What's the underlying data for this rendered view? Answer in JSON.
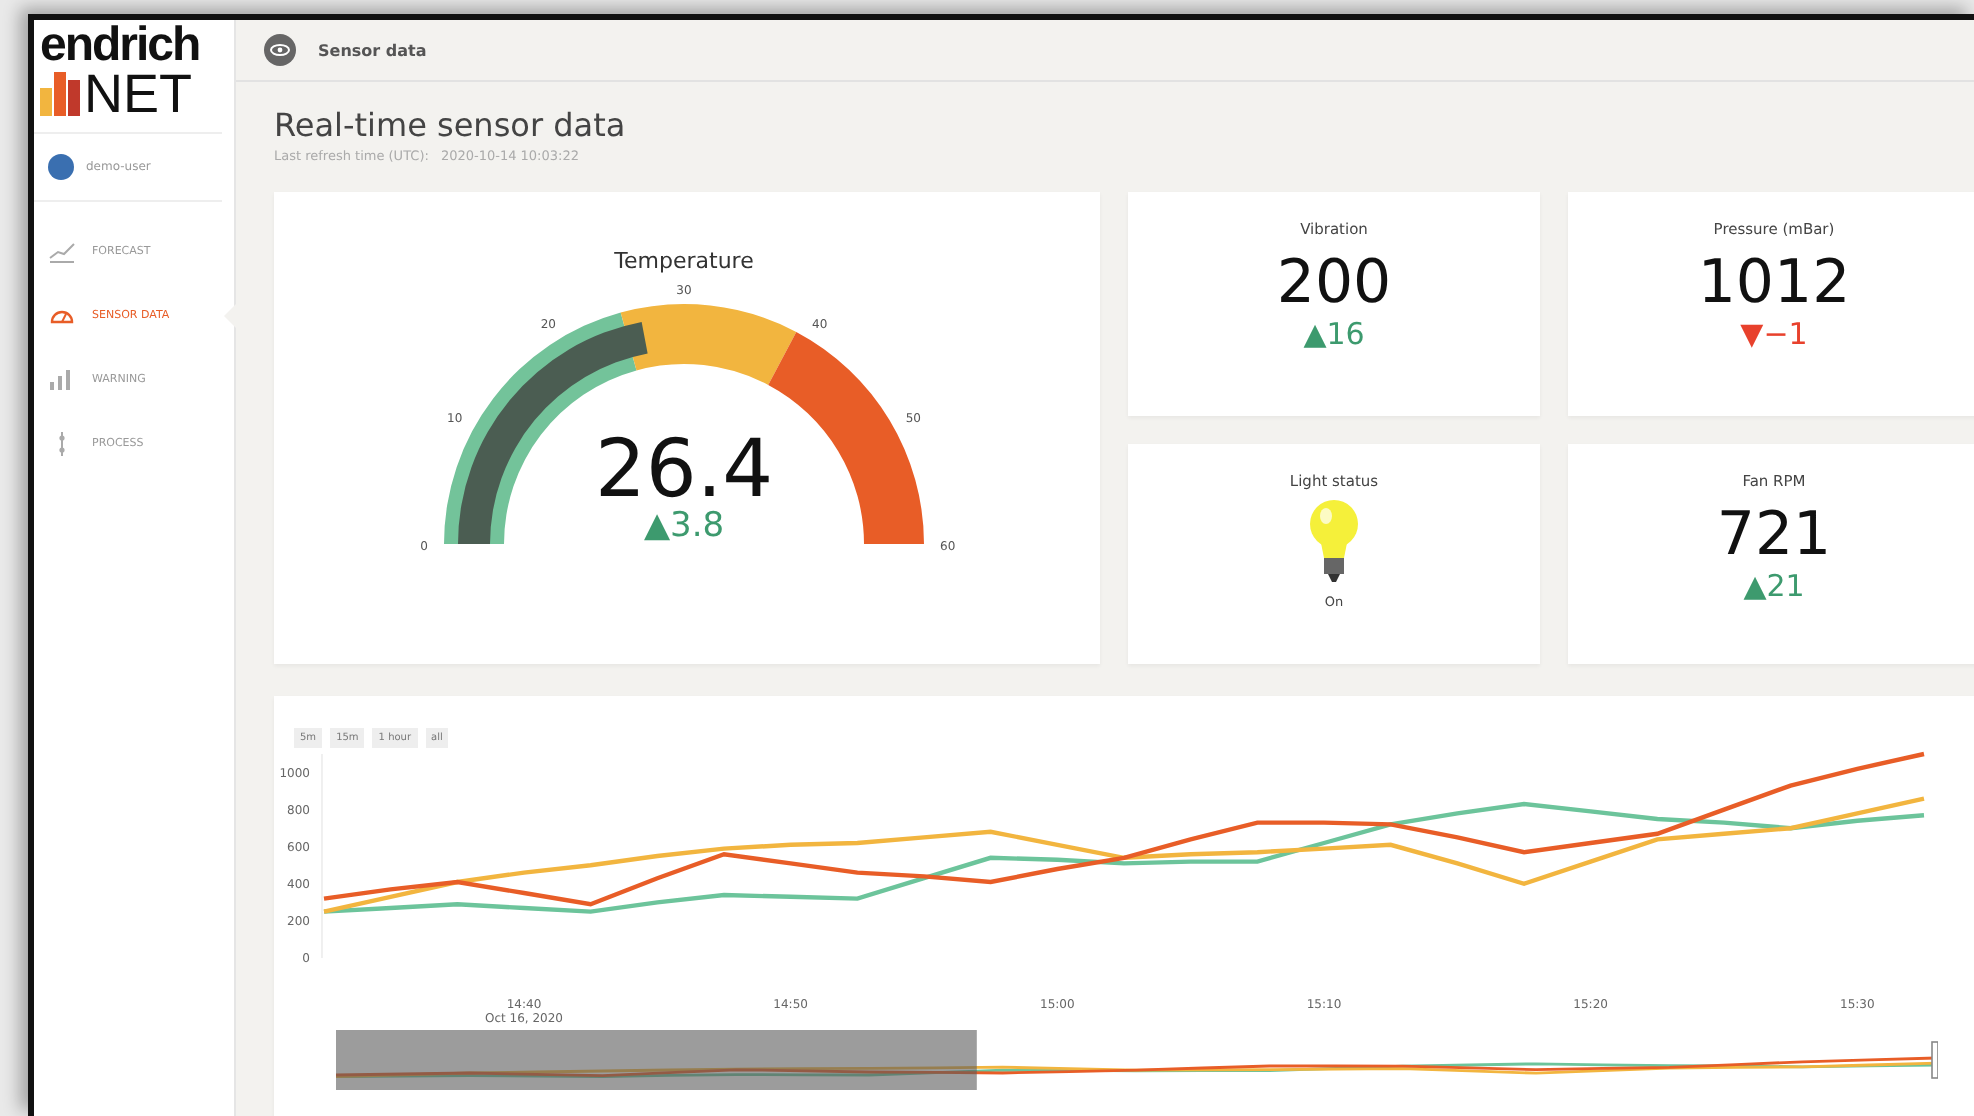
{
  "sidebar": {
    "logo": {
      "top": "endrich",
      "bottom": "NET"
    },
    "user": "demo-user",
    "items": [
      {
        "label": "FORECAST",
        "kind": "forecast",
        "selected": false
      },
      {
        "label": "SENSOR DATA",
        "kind": "sensor",
        "selected": true
      },
      {
        "label": "WARNING",
        "kind": "warning",
        "selected": false
      },
      {
        "label": "PROCESS",
        "kind": "process",
        "selected": false
      }
    ]
  },
  "header": {
    "title": "Sensor data"
  },
  "page": {
    "title": "Real-time sensor data",
    "refresh_label": "Last refresh time (UTC):",
    "refresh_time": "2020-10-14 10:03:22"
  },
  "gauge": {
    "title": "Temperature",
    "value": "26.4",
    "delta": "▲3.8",
    "color": "#3d9a6e",
    "ticks": [
      "0",
      "10",
      "20",
      "30",
      "40",
      "50",
      "60"
    ],
    "bands": [
      {
        "color": "#73c39a"
      },
      {
        "color": "#f2b53f"
      },
      {
        "color": "#e85d27"
      }
    ]
  },
  "cards": [
    {
      "kind": "stat",
      "title": "Vibration",
      "value": "200",
      "delta": "▲16",
      "color": "#3d9a6e"
    },
    {
      "kind": "stat",
      "title": "Pressure (mBar)",
      "value": "1012",
      "delta": "▼−1",
      "color": "#e8412c"
    },
    {
      "kind": "light",
      "title": "Light status",
      "state": "On",
      "on": true
    },
    {
      "kind": "stat",
      "title": "Fan RPM",
      "value": "721",
      "delta": "▲21",
      "color": "#3d9a6e"
    }
  ],
  "timeseries": {
    "range_buttons": [
      "5m",
      "15m",
      "1 hour",
      "all"
    ],
    "date_label": "Oct 16, 2020",
    "range_slider": {
      "level": 0.4
    },
    "chart_data": {
      "type": "line",
      "categories": [
        null,
        null,
        null,
        "14:40",
        null,
        null,
        null,
        "14:50",
        null,
        null,
        null,
        "15:00",
        null,
        null,
        null,
        "15:10",
        null,
        null,
        null,
        "15:20",
        null,
        null,
        null,
        "15:30",
        null
      ],
      "ylim": [
        0,
        1100
      ],
      "yticks": [
        0,
        200,
        400,
        600,
        800,
        1000
      ],
      "series": [
        {
          "color": "#6cc49b",
          "values": [
            250,
            270,
            290,
            270,
            250,
            300,
            340,
            330,
            320,
            430,
            540,
            530,
            510,
            520,
            520,
            620,
            720,
            780,
            830,
            790,
            750,
            730,
            700,
            740,
            770
          ]
        },
        {
          "color": "#f2b53f",
          "values": [
            250,
            330,
            410,
            460,
            500,
            550,
            590,
            610,
            620,
            650,
            680,
            610,
            540,
            560,
            570,
            590,
            610,
            510,
            400,
            520,
            640,
            670,
            700,
            780,
            860
          ]
        },
        {
          "color": "#e85d27",
          "values": [
            320,
            370,
            410,
            350,
            290,
            430,
            560,
            510,
            460,
            440,
            410,
            480,
            540,
            640,
            730,
            730,
            720,
            650,
            570,
            620,
            670,
            800,
            930,
            1020,
            1100
          ]
        }
      ]
    }
  }
}
